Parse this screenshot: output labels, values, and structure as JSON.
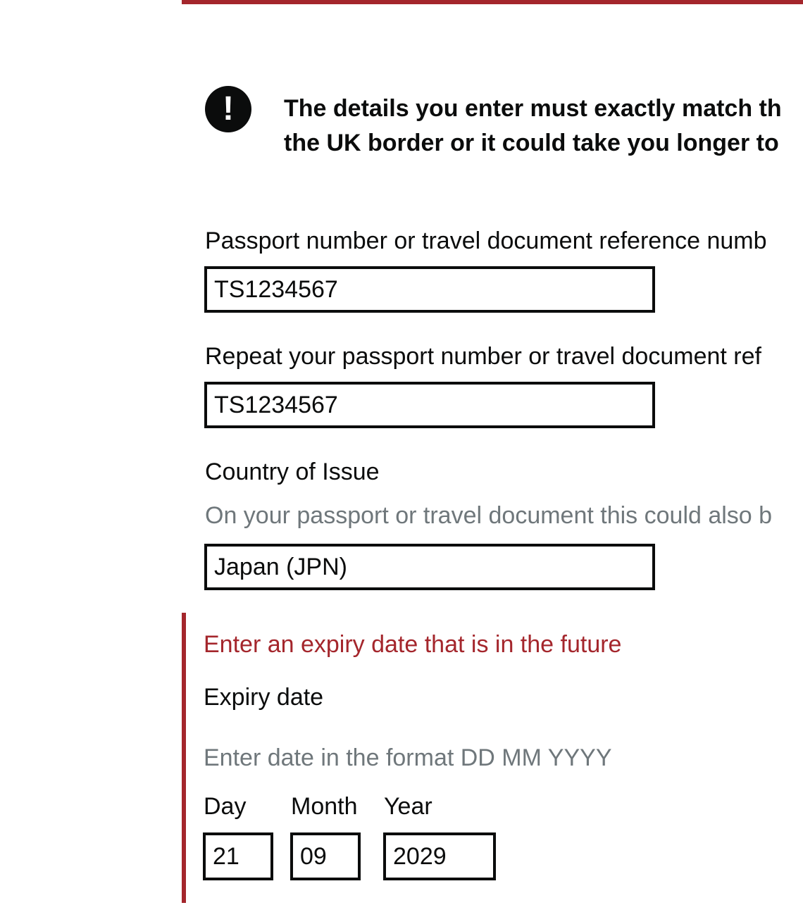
{
  "warning": {
    "icon": "!",
    "line1": "The details you enter must exactly match th",
    "line2": "the UK border or it could take you longer to"
  },
  "passport_number": {
    "label": "Passport number or travel document reference numb",
    "value": "TS1234567"
  },
  "repeat_passport_number": {
    "label": "Repeat your passport number or travel document ref",
    "value": "TS1234567"
  },
  "country_of_issue": {
    "label": "Country of Issue",
    "hint": "On your passport or travel document this could also b",
    "value": "Japan (JPN)"
  },
  "expiry_date": {
    "error": "Enter an expiry date that is in the future",
    "label": "Expiry date",
    "hint": "Enter date in the format DD MM YYYY",
    "day_label": "Day",
    "month_label": "Month",
    "year_label": "Year",
    "day_value": "21",
    "month_value": "09",
    "year_value": "2029"
  },
  "colors": {
    "error": "#a4262c",
    "text": "#0b0c0c",
    "hint": "#6f777b"
  }
}
